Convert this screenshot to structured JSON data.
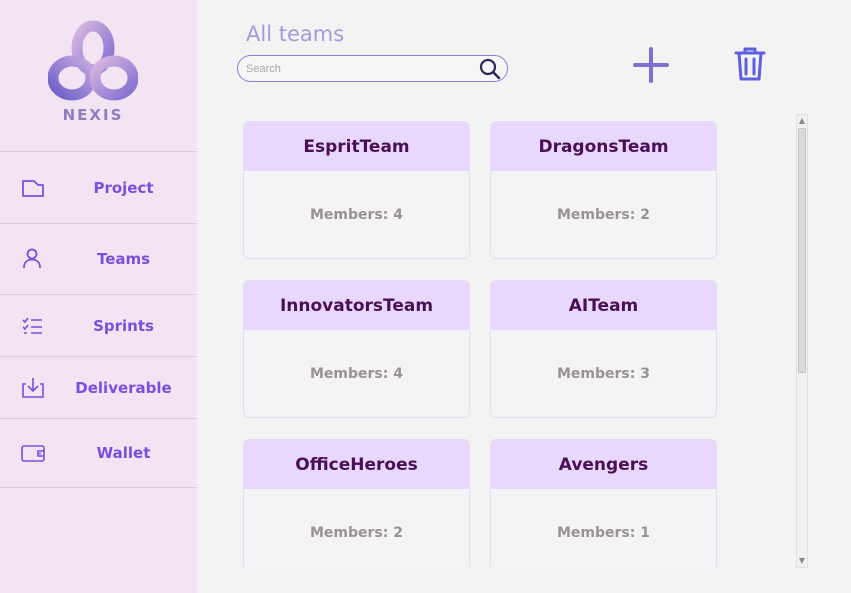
{
  "brand": {
    "name": "NEXIS"
  },
  "sidebar": {
    "items": [
      {
        "label": "Project",
        "icon": "folder-icon"
      },
      {
        "label": "Teams",
        "icon": "user-icon"
      },
      {
        "label": "Sprints",
        "icon": "checklist-icon"
      },
      {
        "label": "Deliverable",
        "icon": "download-icon"
      },
      {
        "label": "Wallet",
        "icon": "wallet-icon"
      }
    ]
  },
  "header": {
    "title": "All teams",
    "search_placeholder": "Search",
    "search_value": "",
    "add_icon": "plus-icon",
    "delete_icon": "trash-icon"
  },
  "teams": [
    {
      "name": "EspritTeam",
      "members": "Members: 4"
    },
    {
      "name": "DragonsTeam",
      "members": "Members: 2"
    },
    {
      "name": "InnovatorsTeam",
      "members": "Members: 4"
    },
    {
      "name": "AITeam",
      "members": "Members: 3"
    },
    {
      "name": "OfficeHeroes",
      "members": "Members: 2"
    },
    {
      "name": "Avengers",
      "members": "Members: 1"
    }
  ],
  "colors": {
    "sidebar_bg": "#f2e4f3",
    "accent": "#7a4fe0",
    "card_header": "#e8d8fd",
    "card_title": "#4a0f55",
    "icon": "#7f6fd0",
    "trash": "#5b5fe0"
  },
  "scrollbar": {
    "up_glyph": "▲",
    "down_glyph": "▼"
  }
}
